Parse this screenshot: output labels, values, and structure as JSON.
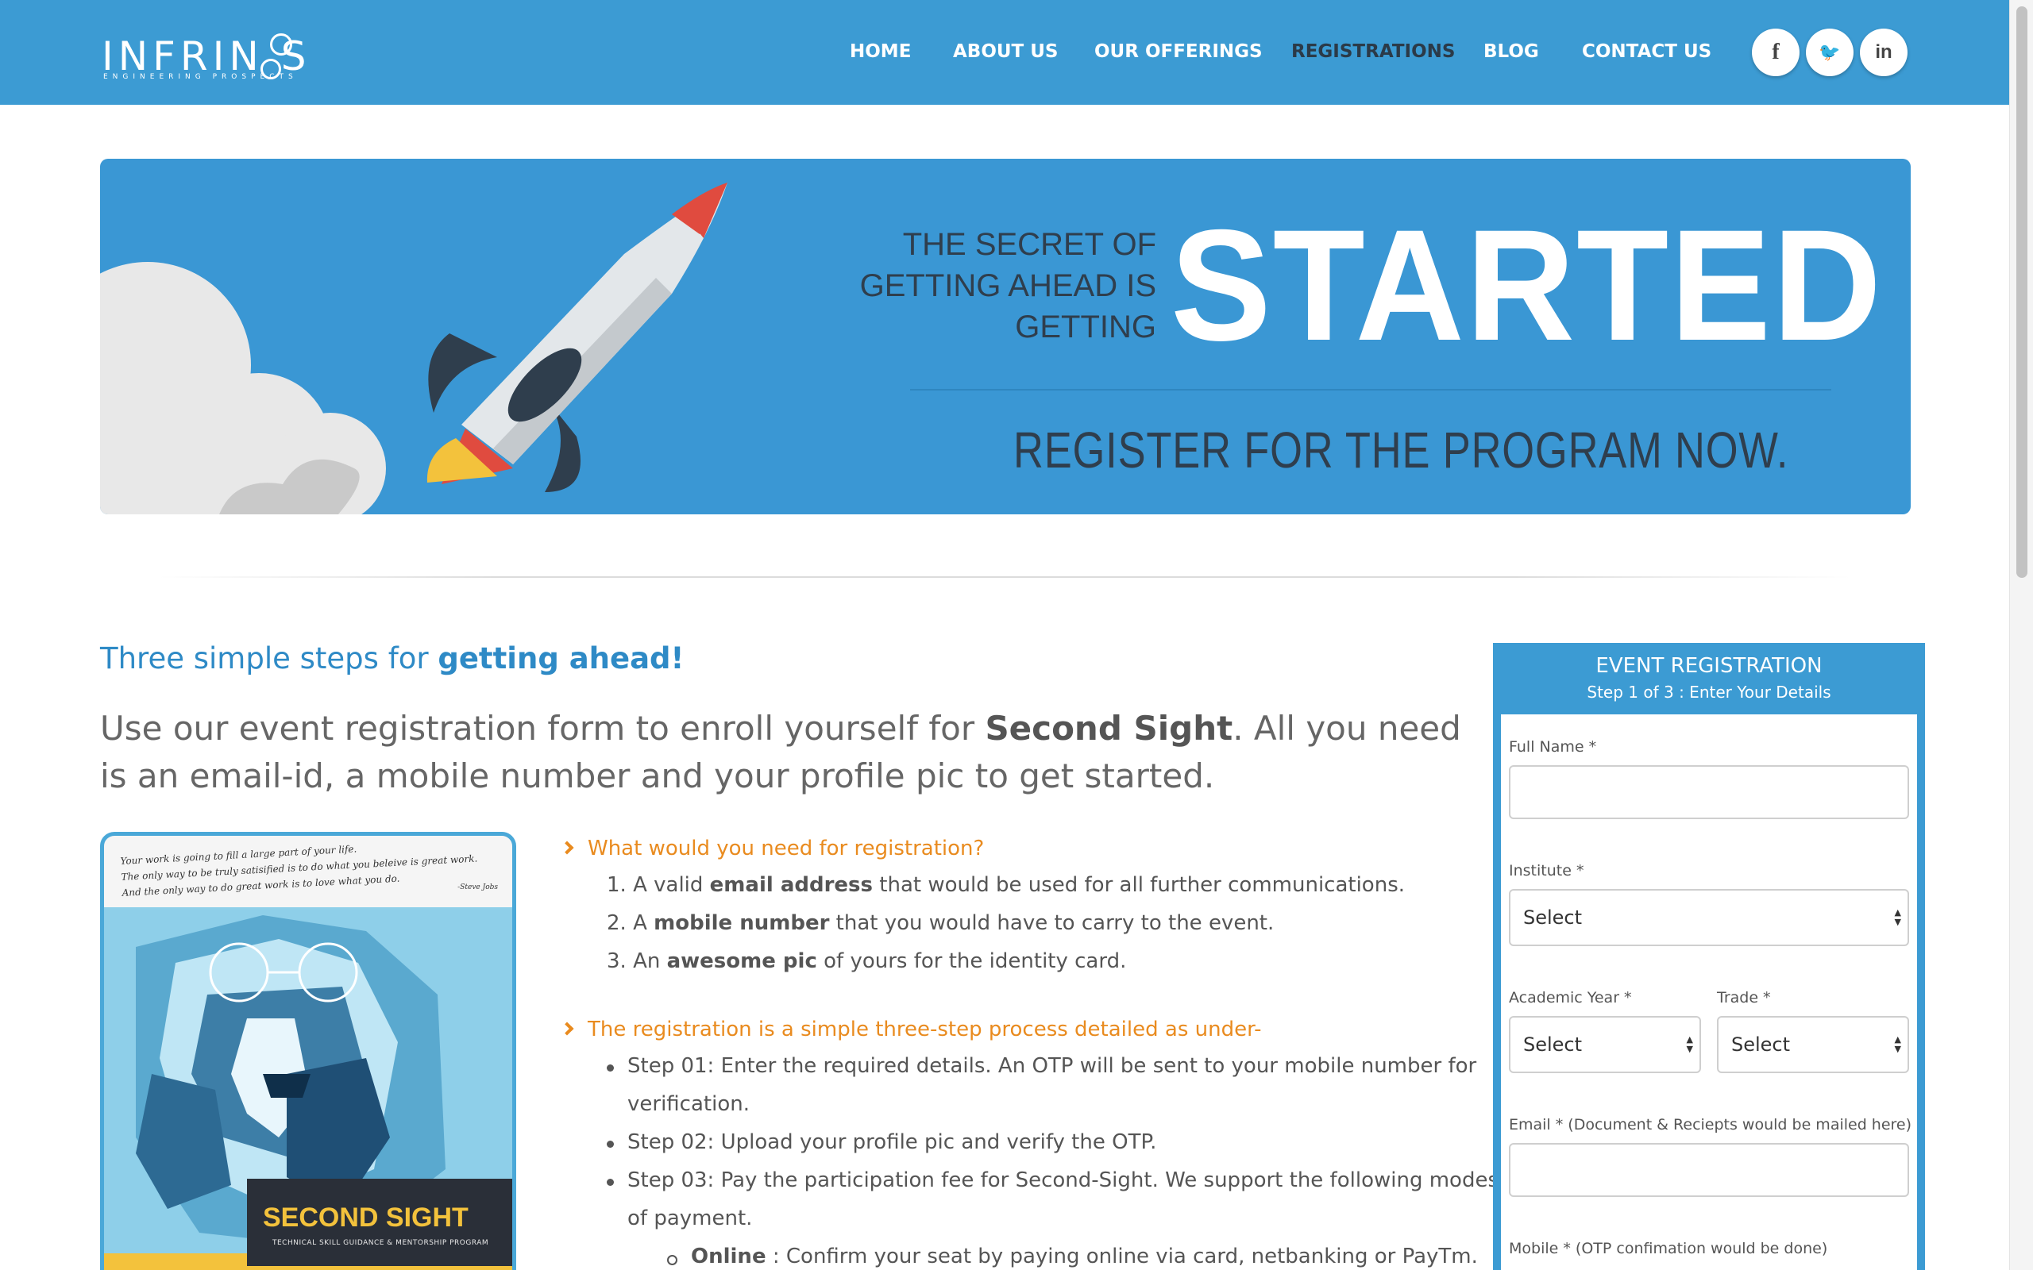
{
  "brand": {
    "logo_text": "INFRIN S",
    "logo_sub": "ENGINEERING PROSPECTS"
  },
  "nav": {
    "items": [
      {
        "label": "HOME"
      },
      {
        "label": "ABOUT US"
      },
      {
        "label": "OUR OFFERINGS"
      },
      {
        "label": "REGISTRATIONS",
        "active": true
      },
      {
        "label": "BLOG"
      },
      {
        "label": "CONTACT US"
      }
    ],
    "social": [
      {
        "icon": "facebook-icon",
        "glyph": "f"
      },
      {
        "icon": "twitter-icon",
        "glyph": "🐦"
      },
      {
        "icon": "linkedin-icon",
        "glyph": "in"
      }
    ]
  },
  "banner": {
    "line1": "THE SECRET OF",
    "line2": "GETTING AHEAD IS",
    "line3": "GETTING",
    "big": "STARTED",
    "cta": "REGISTER FOR THE PROGRAM NOW."
  },
  "content": {
    "heading_plain": "Three simple steps for ",
    "heading_bold": "getting ahead!",
    "intro_a": "Use our event registration form to enroll yourself for ",
    "intro_bold": "Second Sight",
    "intro_b": ". All you need is an email-id, a mobile number and your profile pic to get started."
  },
  "poster": {
    "quote_l1": "Your work is going to fill a large part of your life.",
    "quote_l2": "The only way to be truly satisified is to do what you beleive is great work.",
    "quote_l3": "And the only way to do great work is to love what you do.",
    "author": "-Steve Jobs",
    "title": "SECOND SIGHT",
    "subtitle": "TECHNICAL SKILL GUIDANCE & MENTORSHIP PROGRAM"
  },
  "requirements": {
    "question": "What would you need for registration?",
    "items": [
      {
        "num": "1.",
        "pre": "A valid ",
        "bold": "email address",
        "post": " that would be used for all further communications."
      },
      {
        "num": "2.",
        "pre": "A ",
        "bold": "mobile number",
        "post": " that you would have to carry to the event."
      },
      {
        "num": "3.",
        "pre": "An ",
        "bold": "awesome pic",
        "post": " of yours for the identity card."
      }
    ]
  },
  "process": {
    "question": "The registration is a simple three-step process detailed as under-",
    "step1_a": "Step 01: Enter the required details. An OTP will be sent to your mobile number for",
    "step1_b": "verification.",
    "step2": "Step 02: Upload your profile pic and verify the OTP.",
    "step3_a": "Step 03: Pay the participation fee for Second-Sight. We support the following modes",
    "step3_b": "of payment.",
    "mode_bold": "Online",
    "mode_text": " : Confirm your seat by paying online via card, netbanking or PayTm."
  },
  "form": {
    "title": "EVENT REGISTRATION",
    "step": "Step 1 of 3 : Enter Your Details",
    "full_name_label": "Full Name *",
    "institute_label": "Institute *",
    "institute_value": "Select",
    "year_label": "Academic Year *",
    "year_value": "Select",
    "trade_label": "Trade *",
    "trade_value": "Select",
    "email_label": "Email * (Document & Reciepts would be mailed here)",
    "mobile_label": "Mobile * (OTP confimation would be done)"
  },
  "colors": {
    "brand_blue": "#3c9bd3",
    "accent_orange": "#e98b1f",
    "heading_blue": "#2e8ac6"
  }
}
